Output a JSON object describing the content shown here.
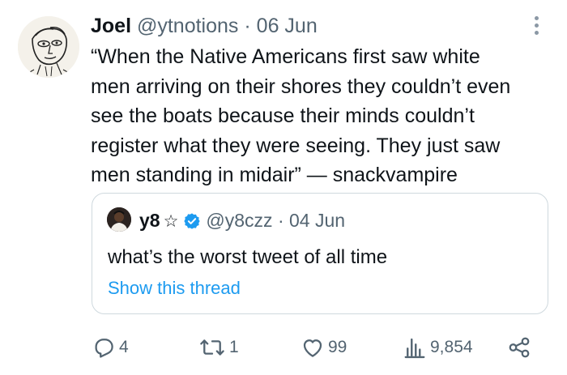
{
  "tweet": {
    "author_name": "Joel",
    "handle": "@ytnotions",
    "separator": "·",
    "date": "06 Jun",
    "text": "“When the Native Americans first saw white\nmen arriving on their shores they couldn’t even\nsee the boats because their minds couldn’t\nregister what they were seeing. They just saw\nmen standing in midair” — snackvampire"
  },
  "quote": {
    "author_name": "y8",
    "star": "☆",
    "handle": "@y8czz",
    "separator": "·",
    "date": "04 Jun",
    "text": "what’s the worst tweet of all time",
    "link": "Show this thread"
  },
  "actions": {
    "replies": "4",
    "retweets": "1",
    "likes": "99",
    "views": "9,854"
  },
  "colors": {
    "text": "#0f1419",
    "muted": "#536471",
    "link": "#1d9bf0",
    "verified": "#1d9bf0",
    "border": "#cfd9de"
  }
}
